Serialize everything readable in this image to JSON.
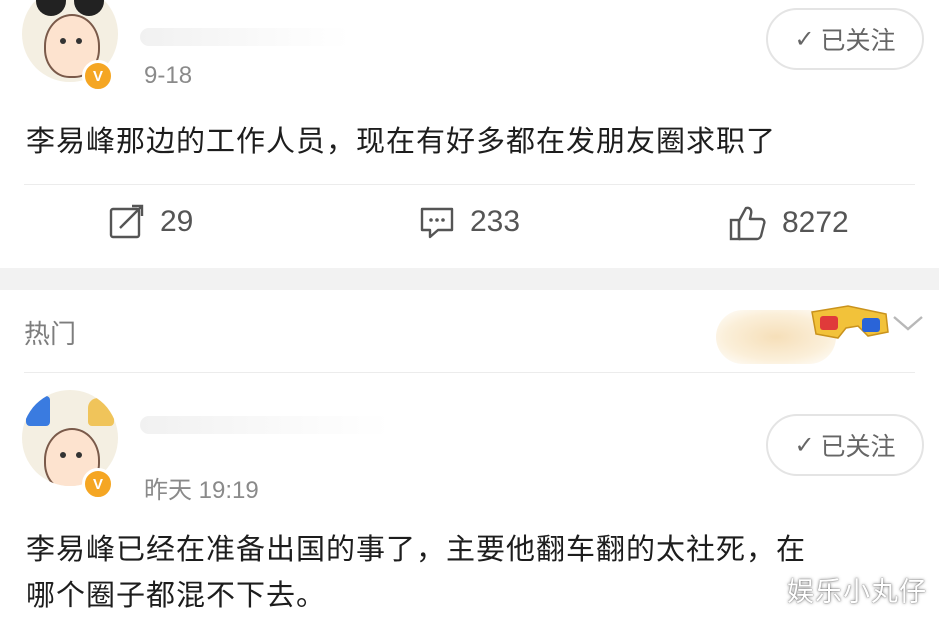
{
  "posts": [
    {
      "date": "9-18",
      "follow_label": "已关注",
      "content": "李易峰那边的工作人员，现在有好多都在发朋友圈求职了",
      "repost_count": "29",
      "comment_count": "233",
      "like_count": "8272"
    },
    {
      "date": "昨天 19:19",
      "follow_label": "已关注",
      "content_line1": "李易峰已经在准备出国的事了，主要他翻车翻的太社死，在",
      "content_line2": "哪个圈子都混不下去。"
    }
  ],
  "section": {
    "hot_label": "热门"
  },
  "watermark": "娱乐小丸仔",
  "colors": {
    "verified_badge": "#f5a623",
    "text_primary": "#1d1d1d",
    "text_secondary": "#8a8a8a",
    "separator_band": "#f2f2f2"
  },
  "icons": {
    "repost": "repost-icon",
    "comment": "comment-icon",
    "like": "thumbs-up-icon",
    "follow": "check-icon",
    "expand": "chevron-down-icon"
  }
}
